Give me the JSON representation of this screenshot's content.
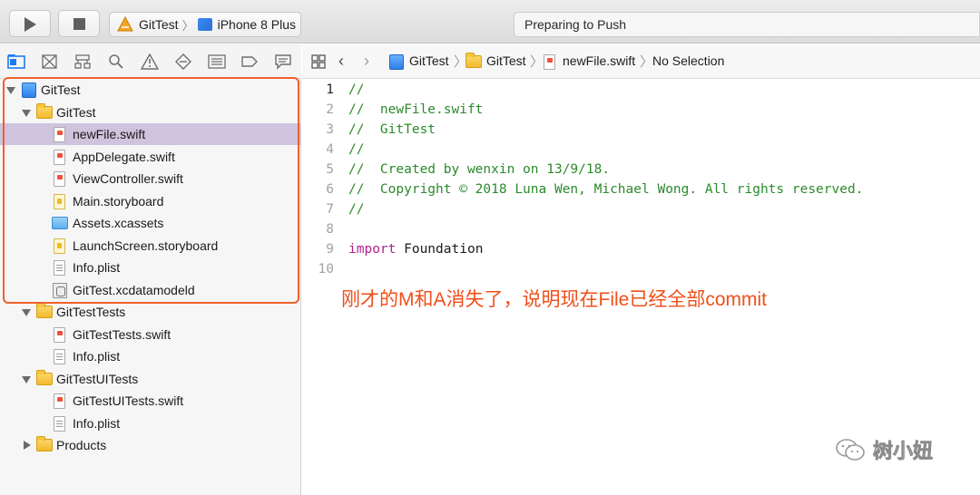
{
  "toolbar": {
    "scheme_target": "GitTest",
    "scheme_device": "iPhone 8 Plus",
    "activity_status": "Preparing to Push",
    "icons": [
      "run-icon",
      "stop-icon",
      "app-target-icon",
      "device-icon"
    ]
  },
  "navigator": {
    "tab_icons": [
      "project-navigator-icon",
      "source-control-navigator-icon",
      "symbol-navigator-icon",
      "find-navigator-icon",
      "issue-navigator-icon",
      "test-navigator-icon",
      "debug-navigator-icon",
      "breakpoint-navigator-icon",
      "report-navigator-icon"
    ],
    "tree": [
      {
        "label": "GitTest",
        "kind": "project",
        "expanded": true
      },
      {
        "label": "GitTest",
        "kind": "folder",
        "expanded": true
      },
      {
        "label": "newFile.swift",
        "kind": "swift",
        "selected": true
      },
      {
        "label": "AppDelegate.swift",
        "kind": "swift"
      },
      {
        "label": "ViewController.swift",
        "kind": "swift"
      },
      {
        "label": "Main.storyboard",
        "kind": "storyboard"
      },
      {
        "label": "Assets.xcassets",
        "kind": "assets"
      },
      {
        "label": "LaunchScreen.storyboard",
        "kind": "storyboard"
      },
      {
        "label": "Info.plist",
        "kind": "plist"
      },
      {
        "label": "GitTest.xcdatamodeld",
        "kind": "xcdatamodel"
      },
      {
        "label": "GitTestTests",
        "kind": "folder",
        "expanded": true
      },
      {
        "label": "GitTestTests.swift",
        "kind": "swift"
      },
      {
        "label": "Info.plist",
        "kind": "plist"
      },
      {
        "label": "GitTestUITests",
        "kind": "folder",
        "expanded": true
      },
      {
        "label": "GitTestUITests.swift",
        "kind": "swift"
      },
      {
        "label": "Info.plist",
        "kind": "plist"
      },
      {
        "label": "Products",
        "kind": "folder",
        "expanded": false
      }
    ]
  },
  "jumpbar": {
    "crumbs": [
      "GitTest",
      "GitTest",
      "newFile.swift",
      "No Selection"
    ]
  },
  "editor": {
    "lines": [
      {
        "n": "1",
        "text": "//",
        "type": "comment"
      },
      {
        "n": "2",
        "text": "//  newFile.swift",
        "type": "comment"
      },
      {
        "n": "3",
        "text": "//  GitTest",
        "type": "comment"
      },
      {
        "n": "4",
        "text": "//",
        "type": "comment"
      },
      {
        "n": "5",
        "text": "//  Created by wenxin on 13/9/18.",
        "type": "comment"
      },
      {
        "n": "6",
        "text": "//  Copyright © 2018 Luna Wen, Michael Wong. All rights reserved.",
        "type": "comment"
      },
      {
        "n": "7",
        "text": "//",
        "type": "comment"
      },
      {
        "n": "8",
        "text": "",
        "type": "plain"
      },
      {
        "n": "9",
        "keyword": "import",
        "text": " Foundation",
        "type": "import"
      },
      {
        "n": "10",
        "text": "",
        "type": "plain"
      }
    ]
  },
  "annotation": "刚才的M和A消失了，说明现在File已经全部commit",
  "watermark": "树小妞",
  "colors": {
    "selection": "#cfc3dd",
    "highlight_border": "#f0602f",
    "annotation": "#f04f1a",
    "comment": "#2b8a2b",
    "keyword": "#b0208e"
  }
}
